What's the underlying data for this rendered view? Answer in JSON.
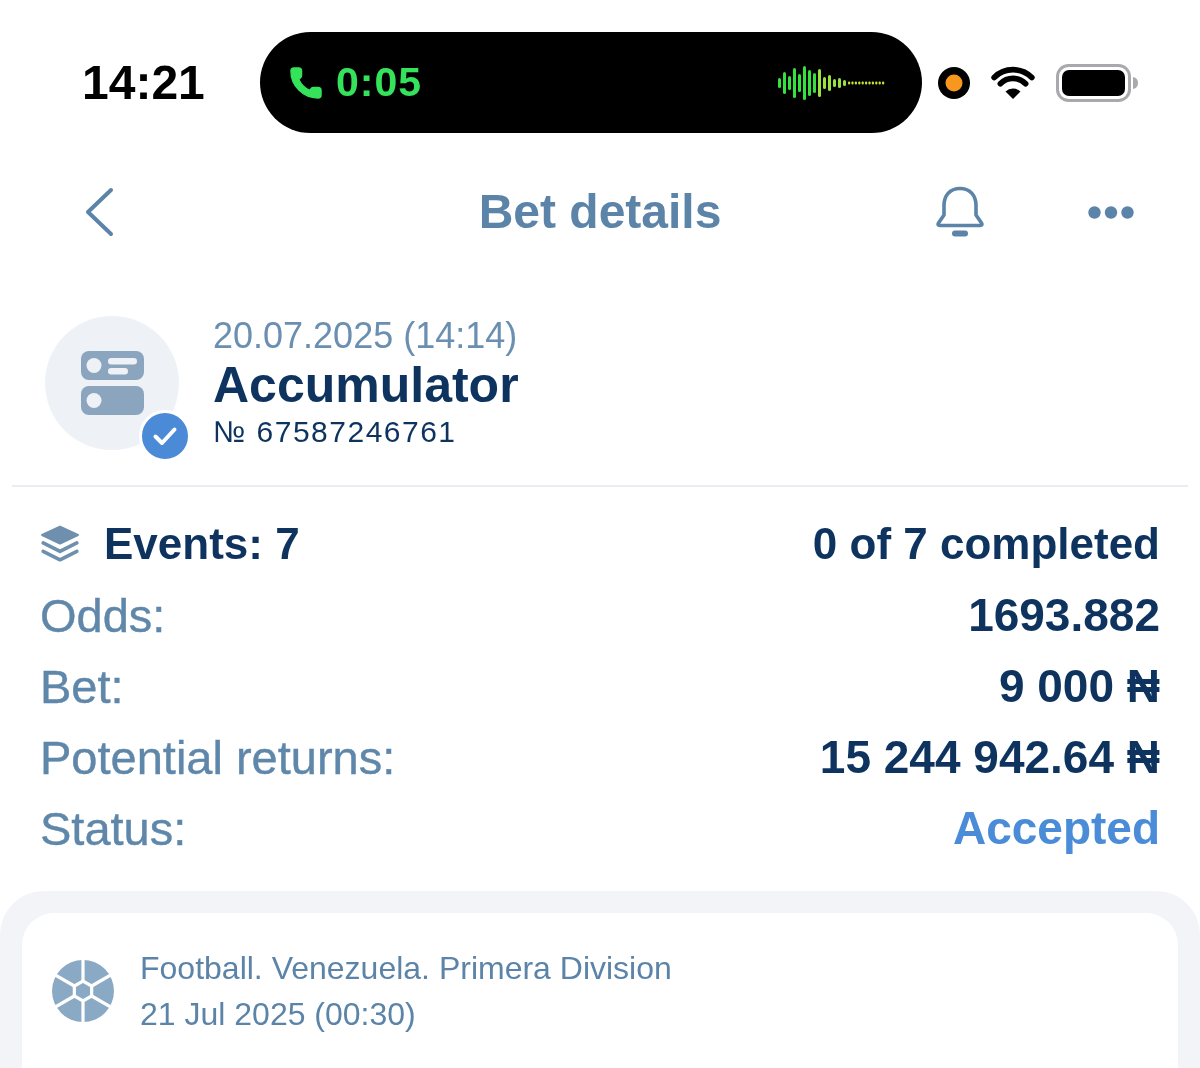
{
  "status_bar": {
    "time": "14:21",
    "call_duration": "0:05"
  },
  "nav": {
    "title": "Bet details"
  },
  "bet": {
    "date": "20.07.2025 (14:14)",
    "type": "Accumulator",
    "number": "№ 67587246761"
  },
  "summary": {
    "events": "Events: 7",
    "completed": "0 of 7 completed"
  },
  "details": [
    {
      "label": "Odds:",
      "value": "1693.882",
      "kind": "number"
    },
    {
      "label": "Bet:",
      "value": "9 000 ₦",
      "kind": "number"
    },
    {
      "label": "Potential returns:",
      "value": "15 244 942.64 ₦",
      "kind": "number"
    },
    {
      "label": "Status:",
      "value": "Accepted",
      "kind": "status"
    }
  ],
  "events": [
    {
      "league": "Football. Venezuela. Primera Division",
      "date": "21 Jul 2025 (00:30)"
    }
  ]
}
